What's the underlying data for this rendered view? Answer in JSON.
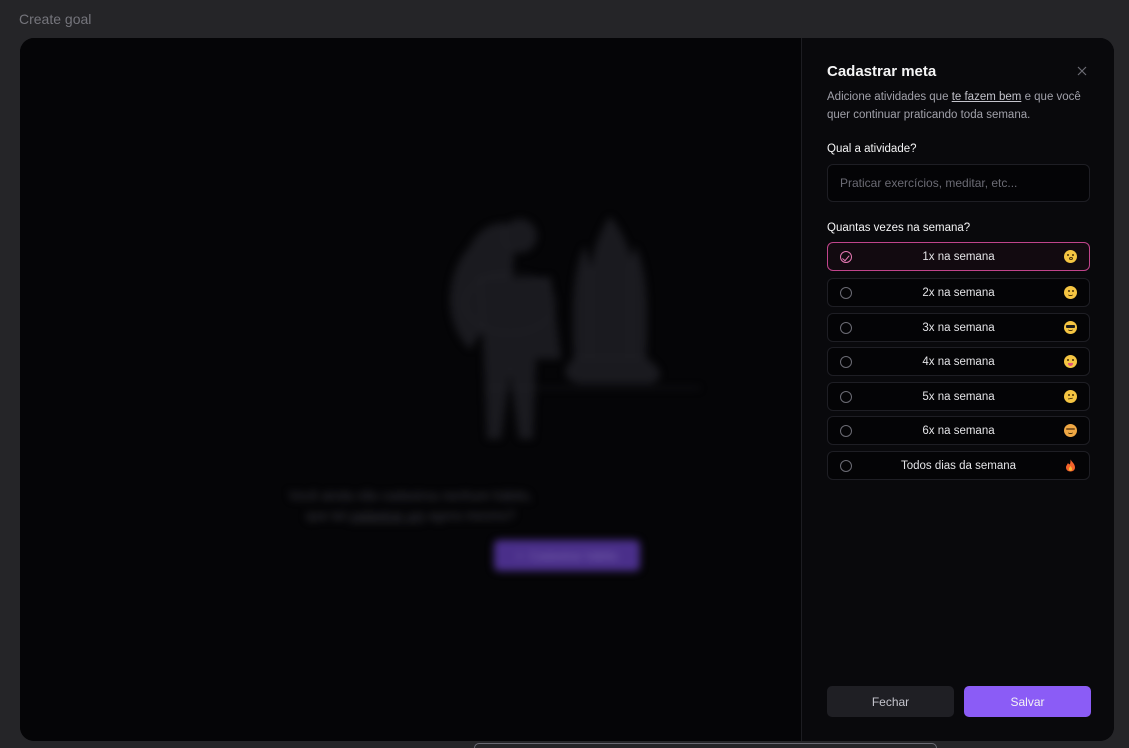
{
  "window": {
    "title": "Create goal"
  },
  "backdrop": {
    "empty_line1": "Você ainda não cadastrou nenhum hábito,",
    "empty_line2_prefix": "que tal",
    "empty_line2_link": "cadastrar um",
    "empty_line2_suffix": "agora mesmo?",
    "cta_icon": "+",
    "cta_label": "Cadastrar hábito"
  },
  "panel": {
    "title": "Cadastrar meta",
    "close_icon": "close-icon",
    "description_prefix": "Adicione atividades que",
    "description_link": "te fazem bem",
    "description_suffix": "e que você quer continuar praticando toda semana.",
    "activity_label": "Qual a atividade?",
    "activity_placeholder": "Praticar exercícios, meditar, etc...",
    "activity_value": "",
    "frequency_label": "Quantas vezes na semana?",
    "options": [
      {
        "label": "1x na semana",
        "emoji": "yawning-face-icon",
        "selected": true
      },
      {
        "label": "2x na semana",
        "emoji": "slightly-smiling-face-icon",
        "selected": false
      },
      {
        "label": "3x na semana",
        "emoji": "sunglasses-face-icon",
        "selected": false
      },
      {
        "label": "4x na semana",
        "emoji": "tongue-face-icon",
        "selected": false
      },
      {
        "label": "5x na semana",
        "emoji": "confused-face-icon",
        "selected": false
      },
      {
        "label": "6x na semana",
        "emoji": "mind-blown-face-icon",
        "selected": false
      },
      {
        "label": "Todos dias da semana",
        "emoji": "fire-icon",
        "selected": false
      }
    ],
    "cancel_label": "Fechar",
    "save_label": "Salvar"
  },
  "colors": {
    "accent": "#8b5cf6",
    "selected_border": "#c0448b",
    "background": "#09090c"
  }
}
